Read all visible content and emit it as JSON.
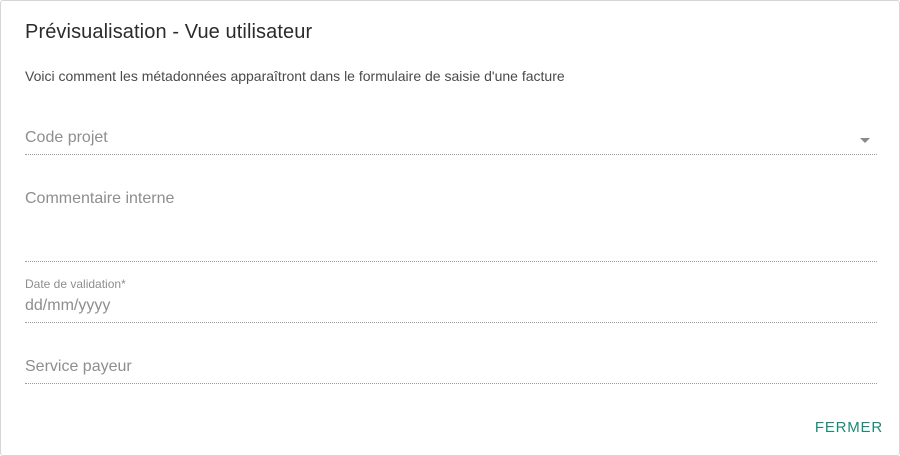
{
  "dialog": {
    "title": "Prévisualisation - Vue utilisateur",
    "subtitle": "Voici comment les métadonnées apparaîtront dans le formulaire de saisie d'une facture"
  },
  "fields": {
    "code_projet": {
      "label": "Code projet",
      "type": "select"
    },
    "commentaire": {
      "label": "Commentaire interne",
      "type": "textarea"
    },
    "date_validation": {
      "label": "Date de validation",
      "required_marker": "*",
      "placeholder": "dd/mm/yyyy"
    },
    "service_payeur": {
      "label": "Service payeur"
    }
  },
  "actions": {
    "close_label": "FERMER"
  },
  "colors": {
    "accent": "#1a8a78",
    "label": "#8e8e8e",
    "title": "#2b2b2b"
  },
  "icons": {
    "select_caret": "caret-down-icon"
  }
}
